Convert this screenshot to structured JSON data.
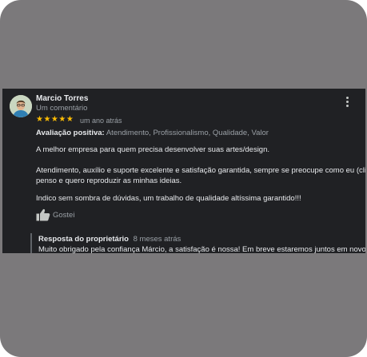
{
  "review": {
    "author": "Marcio Torres",
    "author_meta": "Um comentário",
    "rating": 5,
    "stars": "★★★★★",
    "time": "um ano atrás",
    "positive_label": "Avaliação positiva:",
    "positive_values": "Atendimento, Profissionalismo, Qualidade, Valor",
    "body": [
      "A melhor empresa para quem precisa desenvolver suas artes/design.",
      "Atendimento, auxílio e suporte excelente e satisfação garantida, sempre se preocupe como eu (cliente)",
      "penso e quero reproduzir as minhas ideias.",
      "Indico sem sombra de dúvidas, um trabalho de qualidade altíssima garantido!!!"
    ],
    "like_label": "Gostei"
  },
  "reply": {
    "title": "Resposta do proprietário",
    "time": "8 meses atrás",
    "text": "Muito obrigado pela confiança Márcio, a satisfação é nossa! Em breve estaremos juntos em novos"
  },
  "colors": {
    "card_bg": "#202124",
    "frame_bg": "#7b797b",
    "star": "#fbbc04",
    "text_primary": "#e8eaed",
    "text_secondary": "#9aa0a6"
  },
  "icons": {
    "more": "more-vertical-icon",
    "like": "thumbs-up-icon"
  }
}
